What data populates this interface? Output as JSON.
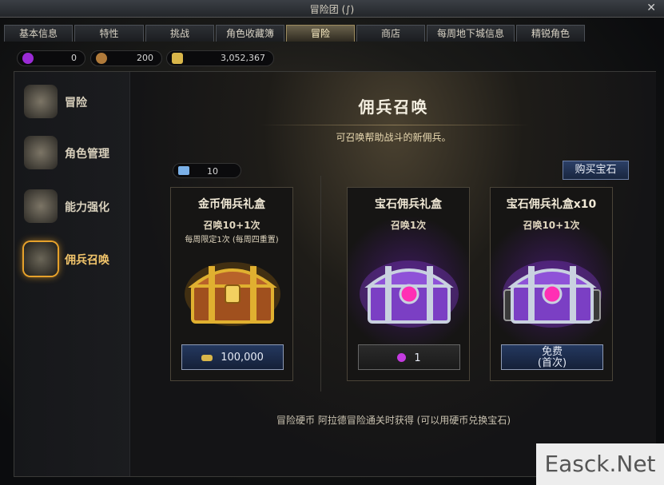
{
  "window": {
    "title": "冒险团 (∫)",
    "close_icon": "close-icon"
  },
  "tabs": [
    {
      "label": "基本信息",
      "active": false
    },
    {
      "label": "特性",
      "active": false
    },
    {
      "label": "挑战",
      "active": false
    },
    {
      "label": "角色收藏簿",
      "active": false
    },
    {
      "label": "冒险",
      "active": true
    },
    {
      "label": "商店",
      "active": false
    },
    {
      "label": "每周地下城信息",
      "active": false
    },
    {
      "label": "精锐角色",
      "active": false
    }
  ],
  "currencies": [
    {
      "icon": "purple-gem-icon",
      "value": "0",
      "color": "#9b2bd6"
    },
    {
      "icon": "bronze-coin-icon",
      "value": "200",
      "color": "#b07a3a"
    },
    {
      "icon": "gold-pile-icon",
      "value": "3,052,367",
      "color": "#d9b64a"
    }
  ],
  "sidebar": {
    "items": [
      {
        "label": "冒险",
        "icon": "book-icon"
      },
      {
        "label": "角色管理",
        "icon": "character-icon"
      },
      {
        "label": "能力强化",
        "icon": "star-icon"
      },
      {
        "label": "佣兵召唤",
        "icon": "chest-icon",
        "active": true
      }
    ]
  },
  "main": {
    "title": "佣兵召唤",
    "subtitle": "可召唤帮助战斗的新佣兵。",
    "ticket_count": "10",
    "buy_button": "购买宝石",
    "cards": [
      {
        "title": "金币佣兵礼盒",
        "line1": "召唤10+1次",
        "line2": "每周限定1次 (每周四重置)",
        "button": "100,000",
        "button_icon": "gold-pile-icon",
        "chest": "gold"
      },
      {
        "title": "宝石佣兵礼盒",
        "line1": "召唤1次",
        "line2": "",
        "button": "1",
        "button_icon": "purple-gem-icon",
        "chest": "purple"
      },
      {
        "title": "宝石佣兵礼盒x10",
        "line1": "召唤10+1次",
        "line2": "",
        "button": "免费",
        "button2": "(首次)",
        "chest": "purple"
      }
    ],
    "footer": "冒险硬币  阿拉德冒险通关时获得 (可以用硬币兑换宝石)"
  },
  "watermark": "Easck.Net",
  "colors": {
    "accent_gold": "#f2c56b",
    "button_blue": "#24385f",
    "chest_purple": "#8a3bd9"
  }
}
